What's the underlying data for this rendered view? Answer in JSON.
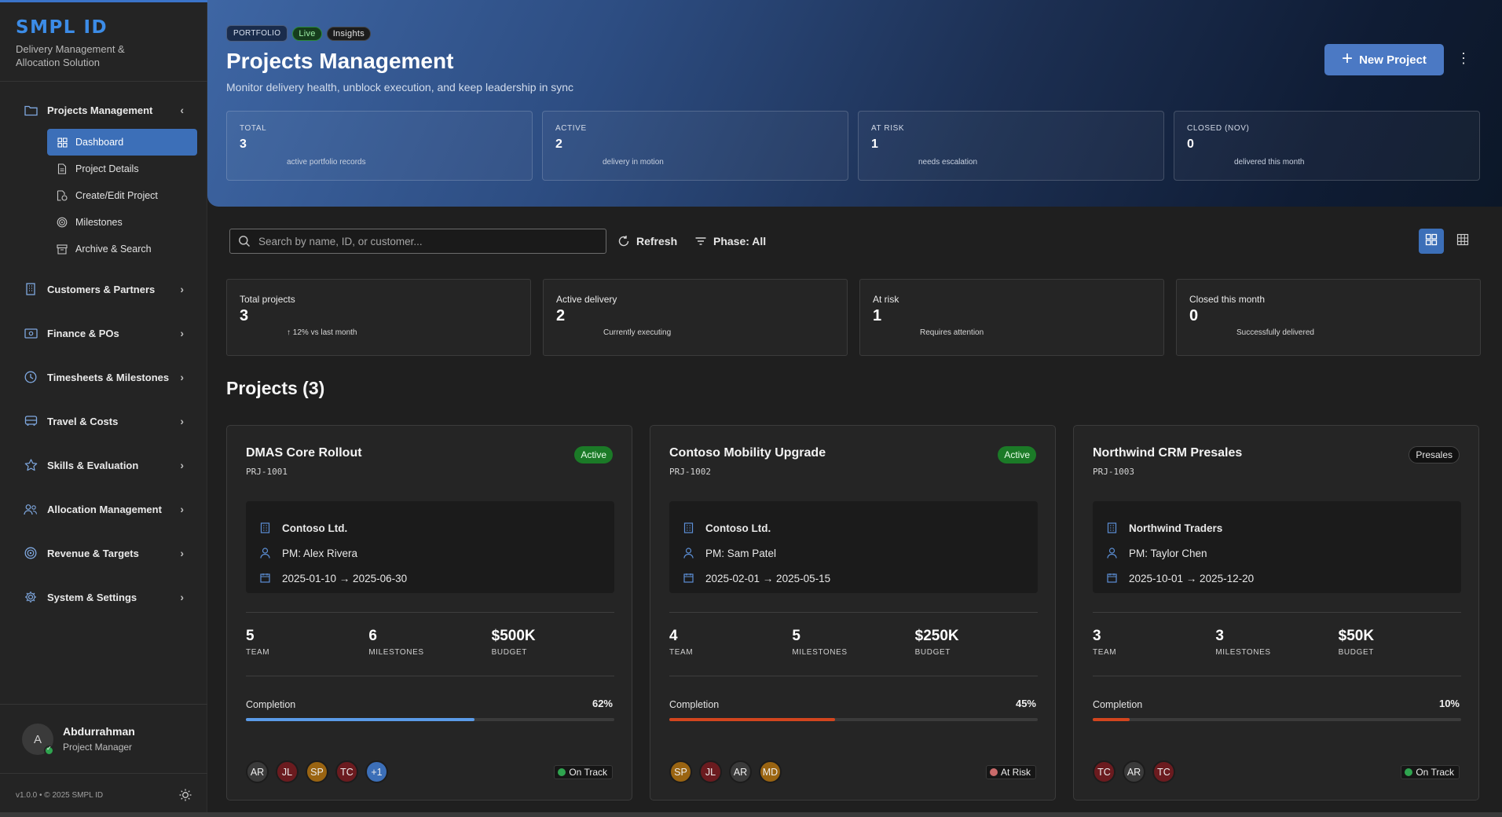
{
  "sidebar": {
    "brand_title": "SMPL ID",
    "brand_subtitle": "Delivery Management & Allocation Solution",
    "items": [
      {
        "label": "Projects Management",
        "icon": "folder-icon",
        "chevron": "‹"
      },
      {
        "label": "Customers & Partners",
        "icon": "building-icon",
        "chevron": "›"
      },
      {
        "label": "Finance & POs",
        "icon": "cash-icon",
        "chevron": "›"
      },
      {
        "label": "Timesheets & Milestones",
        "icon": "clock-icon",
        "chevron": "›"
      },
      {
        "label": "Travel & Costs",
        "icon": "vehicle-icon",
        "chevron": "›"
      },
      {
        "label": "Skills & Evaluation",
        "icon": "star-icon",
        "chevron": "›"
      },
      {
        "label": "Allocation Management",
        "icon": "people-icon",
        "chevron": "›"
      },
      {
        "label": "Revenue & Targets",
        "icon": "target-icon",
        "chevron": "›"
      },
      {
        "label": "System & Settings",
        "icon": "gear-icon",
        "chevron": "›"
      }
    ],
    "subitems": [
      {
        "label": "Dashboard",
        "icon": "grid-icon",
        "active": true
      },
      {
        "label": "Project Details",
        "icon": "document-icon",
        "active": false
      },
      {
        "label": "Create/Edit Project",
        "icon": "edit-document-icon",
        "active": false
      },
      {
        "label": "Milestones",
        "icon": "target-icon",
        "active": false
      },
      {
        "label": "Archive & Search",
        "icon": "archive-icon",
        "active": false
      }
    ],
    "user": {
      "initial": "A",
      "name": "Abdurrahman",
      "role": "Project Manager"
    },
    "footer_text": "v1.0.0 • © 2025 SMPL ID"
  },
  "hero": {
    "chip_portfolio": "PORTFOLIO",
    "chip_live": "Live",
    "chip_insights": "Insights",
    "title": "Projects Management",
    "subtitle": "Monitor delivery health, unblock execution, and keep leadership in sync",
    "new_button": "New Project",
    "more_icon": "⋮",
    "stats": [
      {
        "label": "TOTAL",
        "value": "3",
        "sub": "active portfolio records"
      },
      {
        "label": "ACTIVE",
        "value": "2",
        "sub": "delivery in motion"
      },
      {
        "label": "AT RISK",
        "value": "1",
        "sub": "needs escalation"
      },
      {
        "label": "CLOSED (NOV)",
        "value": "0",
        "sub": "delivered this month"
      }
    ]
  },
  "toolbar": {
    "search_placeholder": "Search by name, ID, or customer...",
    "refresh": "Refresh",
    "phase": "Phase: All"
  },
  "summary": [
    {
      "label": "Total projects",
      "value": "3",
      "sub": "↑ 12% vs last month"
    },
    {
      "label": "Active delivery",
      "value": "2",
      "sub": "Currently executing"
    },
    {
      "label": "At risk",
      "value": "1",
      "sub": "Requires attention"
    },
    {
      "label": "Closed this month",
      "value": "0",
      "sub": "Successfully delivered"
    }
  ],
  "projects_title": "Projects (3)",
  "colors": {
    "accent": "#3c6fb8",
    "green": "#1b7a27",
    "risk_orange": "#d2451e",
    "progress_blue": "#5b9be8"
  },
  "projects": [
    {
      "name": "DMAS Core Rollout",
      "id": "PRJ-1001",
      "badge": "Active",
      "badge_type": "active",
      "customer": "Contoso Ltd.",
      "pm": "PM: Alex Rivera",
      "dates": "2025-01-10 → 2025-06-30",
      "team": "5",
      "team_label": "TEAM",
      "milestones": "6",
      "milestones_label": "MILESTONES",
      "budget": "$500K",
      "budget_label": "BUDGET",
      "completion_label": "Completion",
      "completion_pct": "62%",
      "completion": 0.62,
      "bar_color": "#5b9be8",
      "avatars": [
        {
          "text": "AR",
          "color": "#3a3a3a"
        },
        {
          "text": "JL",
          "color": "#6b1b1f"
        },
        {
          "text": "SP",
          "color": "#9a6411"
        },
        {
          "text": "TC",
          "color": "#6b1b1f"
        },
        {
          "text": "+1",
          "color": "#3c6fb8"
        }
      ],
      "health": "On Track",
      "health_color": "#2fa44f"
    },
    {
      "name": "Contoso Mobility Upgrade",
      "id": "PRJ-1002",
      "badge": "Active",
      "badge_type": "active",
      "customer": "Contoso Ltd.",
      "pm": "PM: Sam Patel",
      "dates": "2025-02-01 → 2025-05-15",
      "team": "4",
      "team_label": "TEAM",
      "milestones": "5",
      "milestones_label": "MILESTONES",
      "budget": "$250K",
      "budget_label": "BUDGET",
      "completion_label": "Completion",
      "completion_pct": "45%",
      "completion": 0.45,
      "bar_color": "#d2451e",
      "avatars": [
        {
          "text": "SP",
          "color": "#9a6411"
        },
        {
          "text": "JL",
          "color": "#6b1b1f"
        },
        {
          "text": "AR",
          "color": "#3a3a3a"
        },
        {
          "text": "MD",
          "color": "#9a6411"
        }
      ],
      "health": "At Risk",
      "health_color": "#c96a6a"
    },
    {
      "name": "Northwind CRM Presales",
      "id": "PRJ-1003",
      "badge": "Presales",
      "badge_type": "presales",
      "customer": "Northwind Traders",
      "pm": "PM: Taylor Chen",
      "dates": "2025-10-01 → 2025-12-20",
      "team": "3",
      "team_label": "TEAM",
      "milestones": "3",
      "milestones_label": "MILESTONES",
      "budget": "$50K",
      "budget_label": "BUDGET",
      "completion_label": "Completion",
      "completion_pct": "10%",
      "completion": 0.1,
      "bar_color": "#d2451e",
      "avatars": [
        {
          "text": "TC",
          "color": "#6b1b1f"
        },
        {
          "text": "AR",
          "color": "#3a3a3a"
        },
        {
          "text": "TC",
          "color": "#6b1b1f"
        }
      ],
      "health": "On Track",
      "health_color": "#2fa44f"
    }
  ]
}
